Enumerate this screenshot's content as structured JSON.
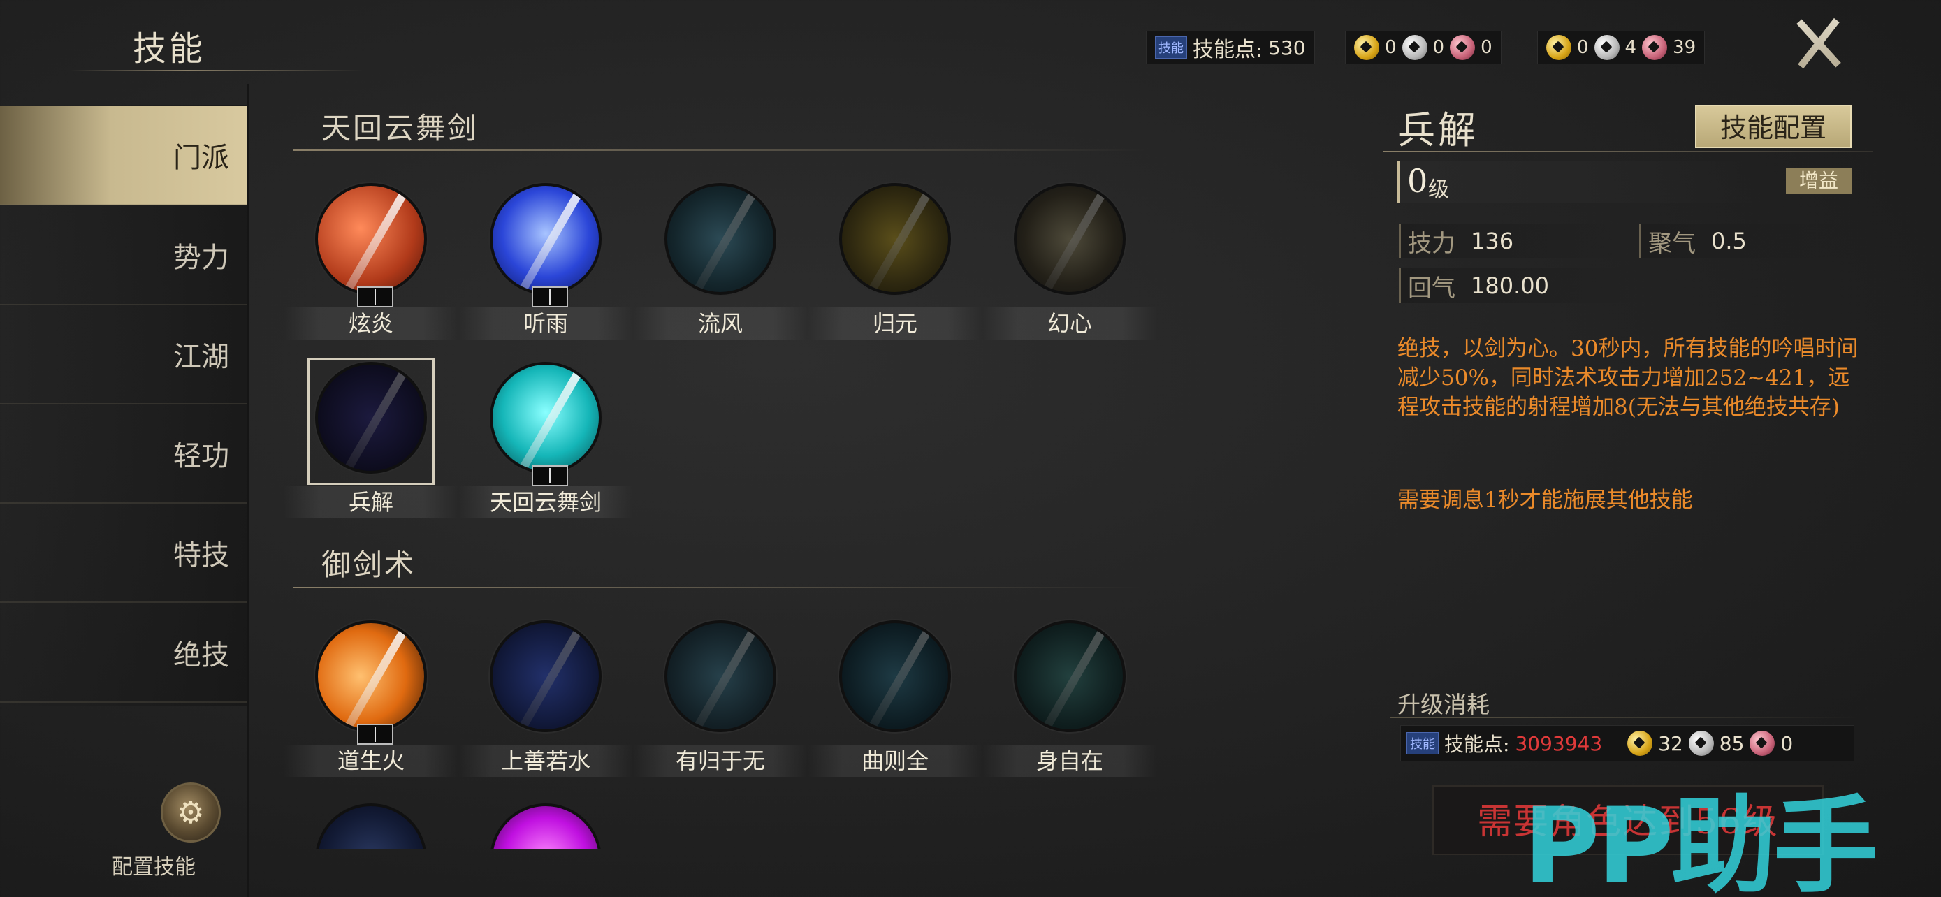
{
  "header": {
    "title": "技能"
  },
  "topbar": {
    "skill_badge": "技能",
    "skill_points_label": "技能点:",
    "skill_points": "530",
    "currency1": [
      "0",
      "0",
      "0"
    ],
    "currency2": [
      "0",
      "4",
      "39"
    ]
  },
  "sidebar": {
    "items": [
      {
        "label": "门派",
        "active": true
      },
      {
        "label": "势力"
      },
      {
        "label": "江湖"
      },
      {
        "label": "轻功"
      },
      {
        "label": "特技"
      },
      {
        "label": "绝技"
      }
    ],
    "config_label": "配置技能"
  },
  "sections": [
    {
      "title": "天回云舞剑",
      "skills": [
        "炫炎",
        "听雨",
        "流风",
        "归元",
        "幻心",
        "兵解",
        "天回云舞剑"
      ]
    },
    {
      "title": "御剑术",
      "skills": [
        "道生火",
        "上善若水",
        "有归于无",
        "曲则全",
        "身自在"
      ]
    }
  ],
  "detail": {
    "name": "兵解",
    "config_button": "技能配置",
    "level": "0",
    "level_unit": "级",
    "tag": "增益",
    "stats": [
      {
        "key": "技力",
        "value": "136"
      },
      {
        "key": "聚气",
        "value": "0.5"
      },
      {
        "key": "回气",
        "value": "180.00"
      }
    ],
    "description": "绝技，以剑为心。30秒内，所有技能的吟唱时间减少50%，同时法术攻击力增加252~421，远程攻击技能的射程增加8(无法与其他绝技共存)",
    "description2": "需要调息1秒才能施展其他技能",
    "upgrade_title": "升级消耗",
    "upgrade_badge": "技能",
    "upgrade_points_label": "技能点:",
    "upgrade_points": "3093943",
    "upgrade_costs": [
      "32",
      "85",
      "0"
    ],
    "requirement": "需要角色达到56级"
  },
  "watermark": "PP助手",
  "colors": {
    "accent": "#d8c99f",
    "description": "#ea8a2a",
    "warning": "#c83434"
  }
}
